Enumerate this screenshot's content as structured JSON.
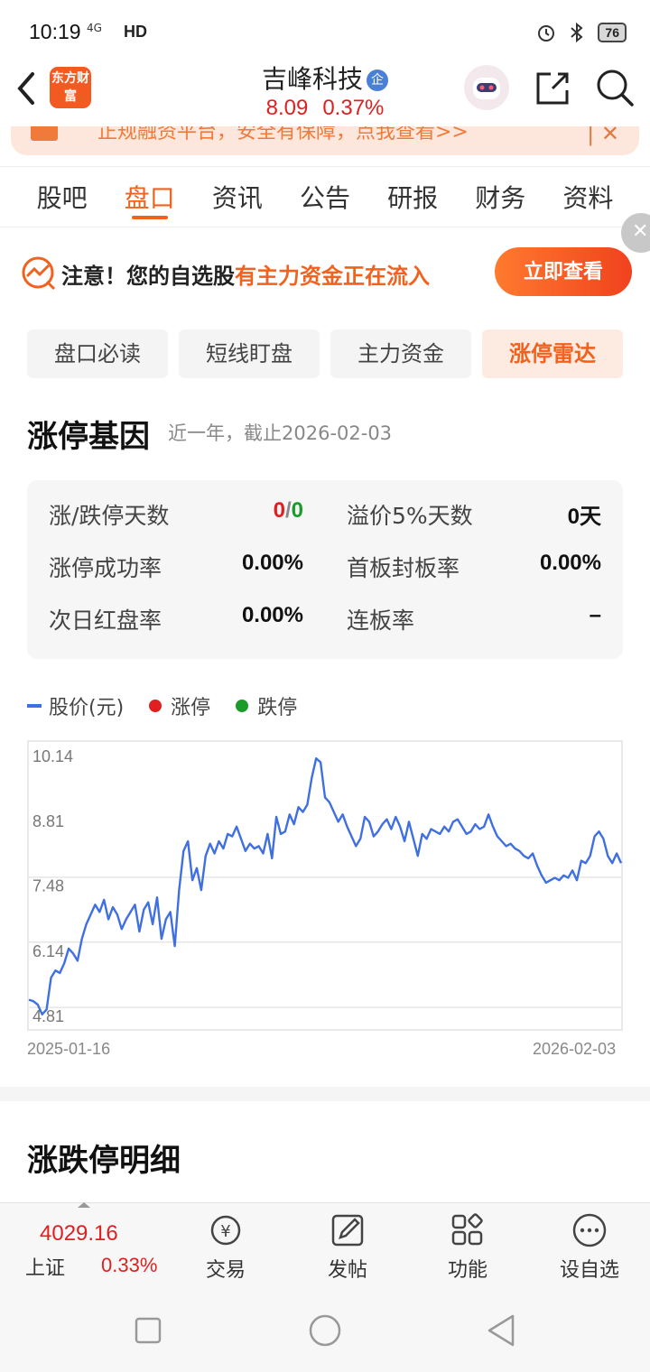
{
  "status_bar": {
    "time": "10:19",
    "network": "4G",
    "hd": "HD",
    "battery": "76"
  },
  "header": {
    "logo_text": "东方财富",
    "stock_name": "吉峰科技",
    "badge": "企",
    "price": "8.09",
    "change_pct": "0.37%"
  },
  "banner": {
    "text": "正规融资平台，安全有保障，点我查看>>"
  },
  "tabs": [
    "股吧",
    "盘口",
    "资讯",
    "公告",
    "研报",
    "财务",
    "资料"
  ],
  "active_tab": "盘口",
  "notice": {
    "prefix": "注意！您的自选股",
    "highlight": "有主力资金正在流入",
    "button": "立即查看"
  },
  "subtabs": [
    "盘口必读",
    "短线盯盘",
    "主力资金",
    "涨停雷达"
  ],
  "active_subtab": "涨停雷达",
  "gene": {
    "title": "涨停基因",
    "subtitle": "近一年，截止2026-02-03"
  },
  "stats": {
    "limit_days_label": "涨/跌停天数",
    "limit_up_days": "0",
    "slash": "/",
    "limit_down_days": "0",
    "premium_label": "溢价5%天数",
    "premium_value": "0天",
    "success_label": "涨停成功率",
    "success_value": "0.00%",
    "first_board_label": "首板封板率",
    "first_board_value": "0.00%",
    "next_day_label": "次日红盘率",
    "next_day_value": "0.00%",
    "consecutive_label": "连板率",
    "consecutive_value": "–"
  },
  "legend": {
    "price": "股价(元)",
    "limit_up": "涨停",
    "limit_down": "跌停"
  },
  "colors": {
    "accent": "#f0621e",
    "up": "#e02020",
    "down": "#1a9b2a",
    "line": "#3f6fe0"
  },
  "chart_data": {
    "type": "line",
    "title": "",
    "xlabel": "",
    "ylabel": "",
    "y_ticks": [
      "10.14",
      "8.81",
      "7.48",
      "6.14",
      "4.81"
    ],
    "ylim": [
      4.81,
      10.14
    ],
    "x_start": "2025-01-16",
    "x_end": "2026-02-03",
    "series": [
      {
        "values": [
          5.15,
          5.12,
          5.05,
          4.85,
          4.95,
          5.6,
          5.75,
          5.7,
          5.9,
          6.2,
          6.1,
          5.95,
          6.4,
          6.7,
          6.9,
          7.1,
          6.95,
          7.2,
          6.8,
          7.05,
          6.9,
          6.6,
          6.8,
          6.95,
          7.1,
          6.55,
          7.0,
          7.15,
          6.7,
          7.25,
          6.4,
          6.8,
          6.95,
          6.25,
          7.4,
          8.2,
          8.4,
          7.6,
          7.85,
          7.4,
          8.1,
          8.35,
          8.15,
          8.4,
          8.25,
          8.55,
          8.5,
          8.7,
          8.45,
          8.2,
          8.35,
          8.25,
          8.3,
          8.15,
          8.55,
          8.05,
          8.9,
          8.55,
          8.6,
          8.95,
          8.75,
          9.1,
          9.0,
          9.15,
          9.7,
          10.1,
          10.02,
          9.3,
          9.2,
          9.0,
          8.8,
          8.95,
          8.7,
          8.5,
          8.3,
          8.45,
          8.9,
          8.8,
          8.5,
          8.6,
          8.75,
          8.85,
          8.65,
          8.9,
          8.7,
          8.4,
          8.8,
          8.45,
          8.1,
          8.55,
          8.45,
          8.65,
          8.6,
          8.55,
          8.7,
          8.6,
          8.8,
          8.85,
          8.7,
          8.55,
          8.6,
          8.75,
          8.65,
          8.7,
          8.95,
          8.7,
          8.5,
          8.4,
          8.3,
          8.35,
          8.25,
          8.2,
          8.1,
          8.05,
          8.15,
          7.9,
          7.7,
          7.55,
          7.6,
          7.65,
          7.6,
          7.7,
          7.65,
          7.8,
          7.6,
          8.0,
          7.95,
          8.1,
          8.5,
          8.6,
          8.45,
          8.1,
          7.95,
          8.15,
          7.95
        ]
      }
    ],
    "grid": true
  },
  "detail_title": "涨跌停明细",
  "bottom_bar": {
    "index_value": "4029.16",
    "index_name": "上证",
    "index_pct": "0.33%",
    "items": [
      "交易",
      "发帖",
      "功能",
      "设自选"
    ]
  }
}
